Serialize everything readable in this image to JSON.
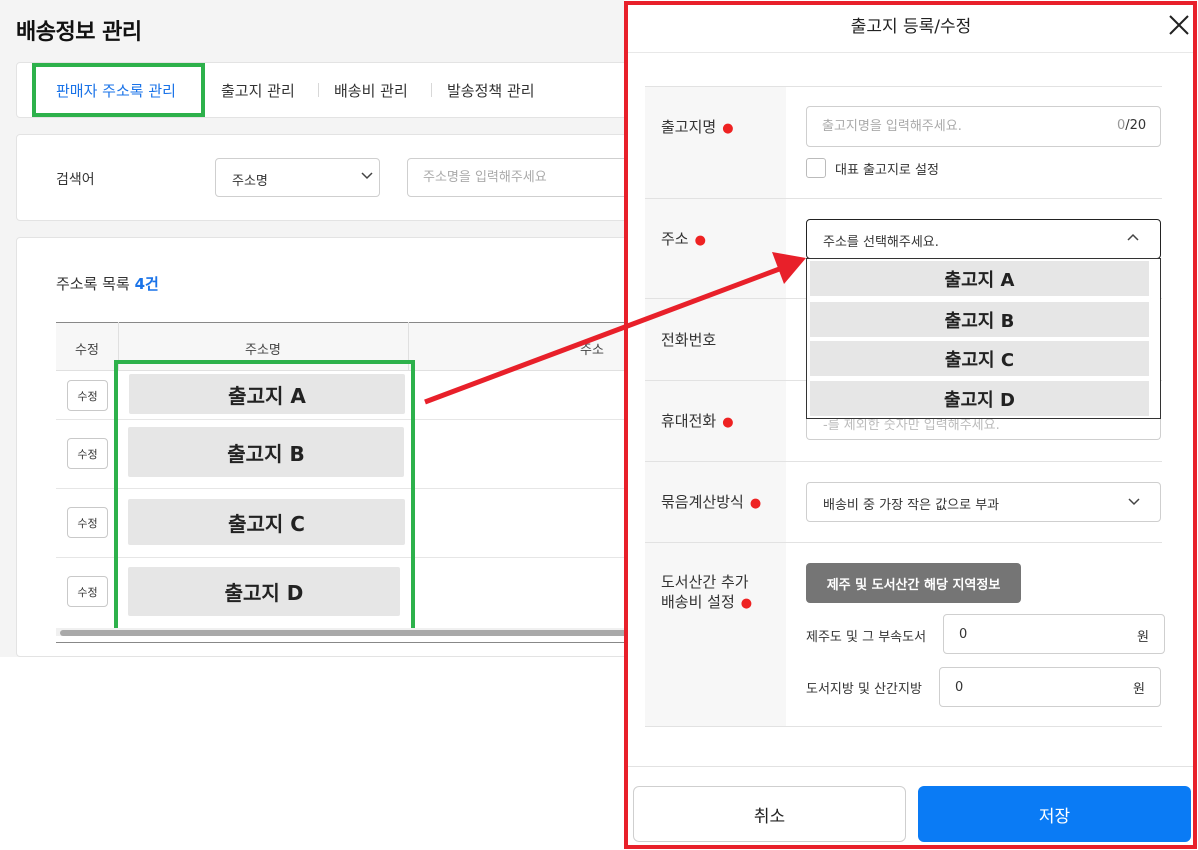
{
  "page": {
    "title": "배송정보 관리",
    "tabs": [
      {
        "label": "판매자 주소록 관리",
        "active": true
      },
      {
        "label": "출고지 관리"
      },
      {
        "label": "배송비 관리"
      },
      {
        "label": "발송정책 관리"
      }
    ],
    "search": {
      "label": "검색어",
      "select_value": "주소명",
      "placeholder": "주소명을 입력해주세요"
    },
    "list": {
      "title": "주소록 목록",
      "count": "4건",
      "columns": [
        "수정",
        "주소명",
        "주소"
      ],
      "rows": [
        {
          "edit": "수정",
          "name": "출고지 A"
        },
        {
          "edit": "수정",
          "name": "출고지 B"
        },
        {
          "edit": "수정",
          "name": "출고지 C"
        },
        {
          "edit": "수정",
          "name": "출고지 D"
        }
      ]
    }
  },
  "modal": {
    "title": "출고지 등록/수정",
    "fields": {
      "name": {
        "label": "출고지명",
        "placeholder": "출고지명을 입력해주세요.",
        "counter_current": "0",
        "counter_max": "/20",
        "checkbox_label": "대표 출고지로 설정"
      },
      "address": {
        "label": "주소",
        "placeholder": "주소를 선택해주세요.",
        "options": [
          "출고지 A",
          "출고지 B",
          "출고지 C",
          "출고지 D"
        ]
      },
      "phone": {
        "label": "전화번호"
      },
      "mobile": {
        "label": "휴대전화",
        "placeholder_partial": "-를 제외한 숫자만 입력해주세요."
      },
      "bundle": {
        "label": "묶음계산방식",
        "value": "배송비 중 가장 작은 값으로 부과"
      },
      "island": {
        "label_line1": "도서산간 추가",
        "label_line2": "배송비 설정",
        "region_button": "제주 및 도서산간 해당 지역정보",
        "jeju_label": "제주도 및 그 부속도서",
        "jeju_value": "0",
        "other_label": "도서지방 및 산간지방",
        "other_value": "0",
        "unit": "원"
      }
    },
    "buttons": {
      "cancel": "취소",
      "save": "저장"
    }
  },
  "colors": {
    "accent_blue": "#0a7bf5",
    "highlight_green": "#2db14b",
    "highlight_red": "#e8202a",
    "required_dot": "#e22222"
  }
}
